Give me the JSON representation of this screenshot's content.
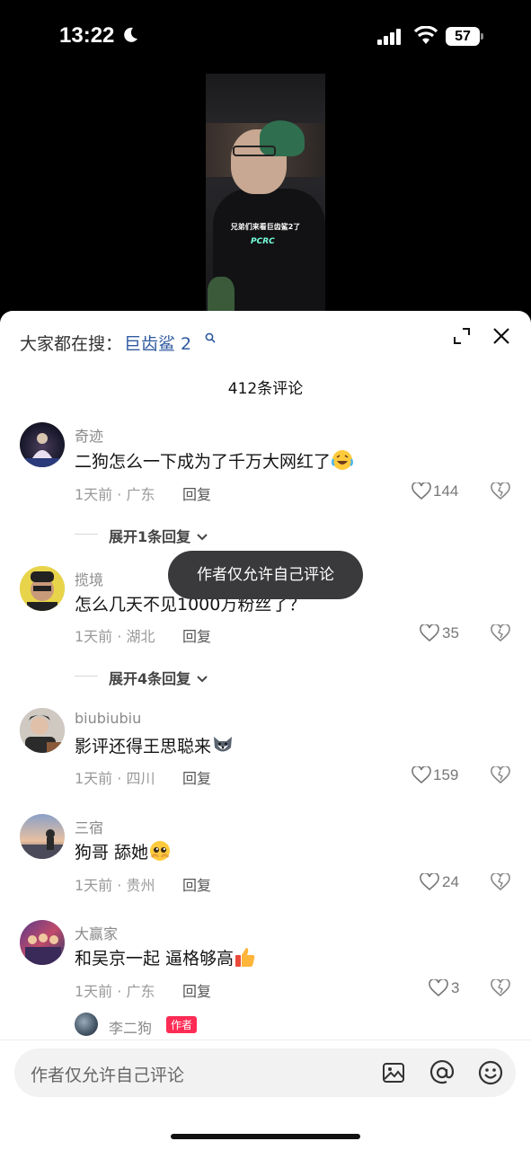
{
  "status_bar": {
    "time": "13:22",
    "battery": "57"
  },
  "video": {
    "caption": "兄弟们来看巨齿鲨2了",
    "logo": "PCRC"
  },
  "header": {
    "search_prefix": "大家都在搜：",
    "search_term": "巨齿鲨 2",
    "comment_count": "412条评论"
  },
  "comments": [
    {
      "user": "奇迹",
      "text": "二狗怎么一下成为了千万大网红了",
      "meta": "1天前 · 广东",
      "reply": "回复",
      "likes": "144",
      "expand": "展开1条回复"
    },
    {
      "user": "揽境",
      "text": "怎么几天不见1000万粉丝了？",
      "meta": "1天前 · 湖北",
      "reply": "回复",
      "likes": "35",
      "expand": "展开4条回复"
    },
    {
      "user": "biubiubiu",
      "text": "影评还得王思聪来",
      "meta": "1天前 · 四川",
      "reply": "回复",
      "likes": "159"
    },
    {
      "user": "三宿",
      "text": "狗哥 舔她",
      "meta": "1天前 · 贵州",
      "reply": "回复",
      "likes": "24"
    },
    {
      "user": "大赢家",
      "text": "和吴京一起 逼格够高",
      "meta": "1天前 · 广东",
      "reply": "回复",
      "likes": "3"
    }
  ],
  "author_reply": {
    "name": "李二狗",
    "badge": "作者"
  },
  "toast": "作者仅允许自己评论",
  "input": {
    "placeholder": "作者仅允许自己评论"
  },
  "colors": {
    "link": "#2f5aa0",
    "badge": "#fe2c55",
    "toast_bg": "#3a3a3c"
  }
}
